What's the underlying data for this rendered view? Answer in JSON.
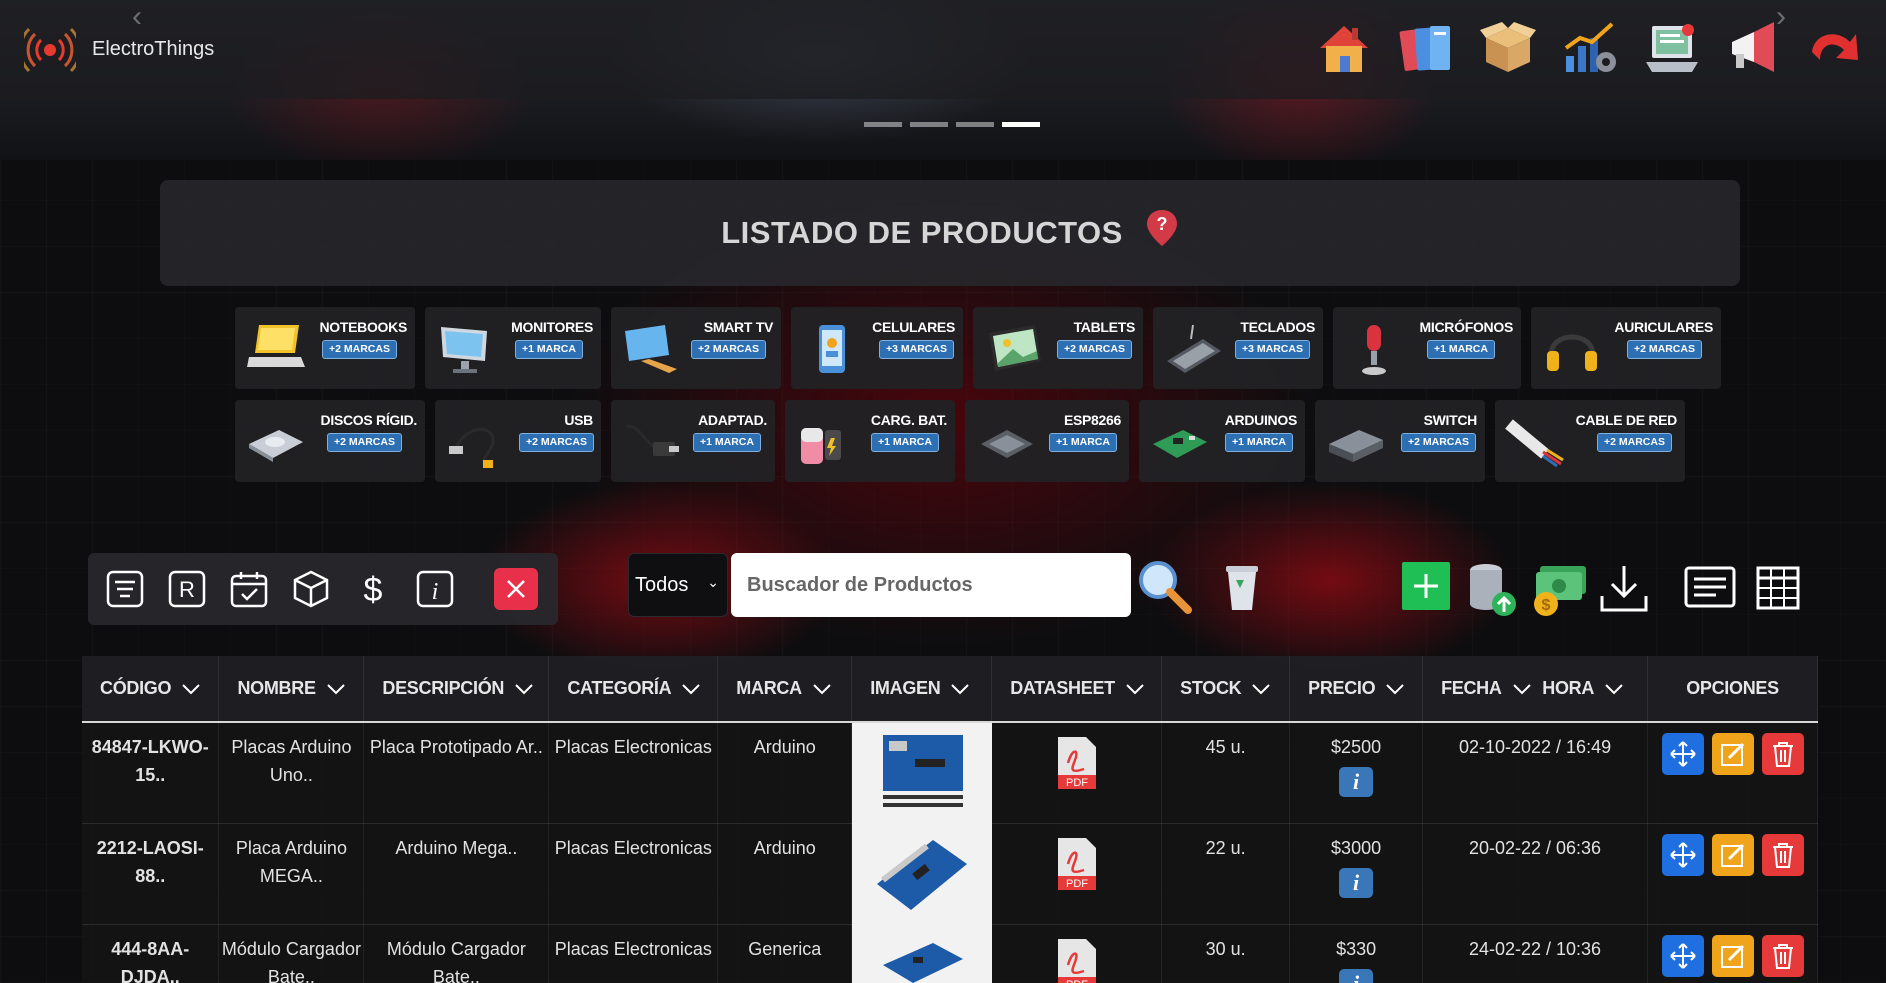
{
  "app": {
    "brand": "ElectroThings"
  },
  "nav": {
    "icons": [
      "home-icon",
      "files-icon",
      "box-icon",
      "stats-icon",
      "laptop-icon",
      "megaphone-icon",
      "logout-icon"
    ]
  },
  "page": {
    "title": "LISTADO DE PRODUCTOS"
  },
  "categories_row1": [
    {
      "name": "NOTEBOOKS",
      "badge": "+2 MARCAS"
    },
    {
      "name": "MONITORES",
      "badge": "+1 MARCA"
    },
    {
      "name": "SMART TV",
      "badge": "+2 MARCAS"
    },
    {
      "name": "CELULARES",
      "badge": "+3 MARCAS"
    },
    {
      "name": "TABLETS",
      "badge": "+2 MARCAS"
    },
    {
      "name": "TECLADOS",
      "badge": "+3 MARCAS"
    },
    {
      "name": "MICRÓFONOS",
      "badge": "+1 MARCA"
    },
    {
      "name": "AURICULARES",
      "badge": "+2 MARCAS"
    }
  ],
  "categories_row2": [
    {
      "name": "DISCOS RÍGID.",
      "badge": "+2 MARCAS"
    },
    {
      "name": "USB",
      "badge": "+2 MARCAS"
    },
    {
      "name": "ADAPTAD.",
      "badge": "+1 MARCA"
    },
    {
      "name": "CARG. BAT.",
      "badge": "+1 MARCA"
    },
    {
      "name": "ESP8266",
      "badge": "+1 MARCA"
    },
    {
      "name": "ARDUINOS",
      "badge": "+1 MARCA"
    },
    {
      "name": "SWITCH",
      "badge": "+2 MARCAS"
    },
    {
      "name": "CABLE DE RED",
      "badge": "+2 MARCAS"
    }
  ],
  "filter": {
    "select": "Todos",
    "search_placeholder": "Buscador de Productos"
  },
  "table": {
    "headers": {
      "codigo": "CÓDIGO",
      "nombre": "NOMBRE",
      "descripcion": "DESCRIPCIÓN",
      "categoria": "CATEGORÍA",
      "marca": "MARCA",
      "imagen": "IMAGEN",
      "datasheet": "DATASHEET",
      "stock": "STOCK",
      "precio": "PRECIO",
      "fecha": "FECHA",
      "hora": "HORA",
      "opciones": "OPCIONES"
    },
    "rows": [
      {
        "codigo": "84847-LKWO-15..",
        "nombre": "Placas Arduino Uno..",
        "descripcion": "Placa Prototipado Ar..",
        "categoria": "Placas Electronicas",
        "marca": "Arduino",
        "stock": "45 u.",
        "precio": "$2500",
        "fecha_hora": "02-10-2022 / 16:49"
      },
      {
        "codigo": "2212-LAOSI-88..",
        "nombre": "Placa Arduino MEGA..",
        "descripcion": "Arduino Mega..",
        "categoria": "Placas Electronicas",
        "marca": "Arduino",
        "stock": "22 u.",
        "precio": "$3000",
        "fecha_hora": "20-02-22 / 06:36"
      },
      {
        "codigo": "444-8AA-DJDA..",
        "nombre": "Módulo Cargador Bate..",
        "descripcion": "Módulo Cargador Bate..",
        "categoria": "Placas Electronicas",
        "marca": "Generica",
        "stock": "30 u.",
        "precio": "$330",
        "fecha_hora": "24-02-22 / 10:36"
      }
    ]
  },
  "pdf_label": "PDF",
  "info_label": "i",
  "colors": {
    "accent": "#e8304a",
    "badge": "#2d6fb3",
    "add": "#1fbf55"
  }
}
